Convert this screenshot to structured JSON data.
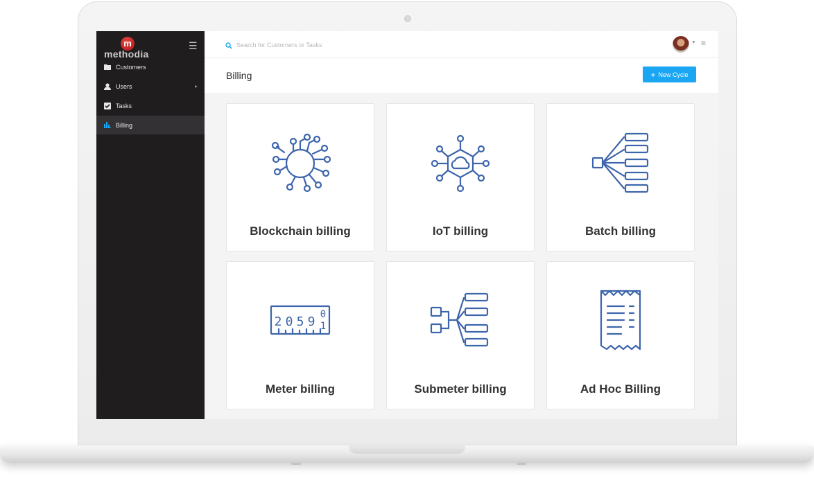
{
  "brand": {
    "logo_letter": "m",
    "logo_text": "methodia"
  },
  "sidebar": {
    "items": [
      {
        "label": "Customers",
        "icon": "folder-icon",
        "active": false
      },
      {
        "label": "Users",
        "icon": "user-icon",
        "active": false,
        "has_submenu": true
      },
      {
        "label": "Tasks",
        "icon": "checkbox-icon",
        "active": false
      },
      {
        "label": "Billing",
        "icon": "bar-chart-icon",
        "active": true
      }
    ]
  },
  "topbar": {
    "search_placeholder": "Search for Customers or Tasks"
  },
  "page": {
    "title": "Billing",
    "new_button_label": "New Cycle"
  },
  "cards": [
    {
      "label": "Blockchain billing",
      "icon": "blockchain-chip-icon"
    },
    {
      "label": "IoT billing",
      "icon": "iot-cloud-network-icon"
    },
    {
      "label": "Batch billing",
      "icon": "batch-tree-icon"
    },
    {
      "label": "Meter billing",
      "icon": "meter-counter-icon"
    },
    {
      "label": "Submeter billing",
      "icon": "submeter-tree-icon"
    },
    {
      "label": "Ad Hoc Billing",
      "icon": "receipt-icon"
    }
  ],
  "meter_display": {
    "digits": [
      "2",
      "0",
      "5",
      "9"
    ],
    "rolling_top": "0",
    "rolling_bottom": "1"
  },
  "colors": {
    "accent": "#1aa6f3",
    "icon_stroke": "#3d65ab",
    "sidebar_bg": "#1f1d1e",
    "sidebar_active": "#333133",
    "logo_red": "#c8201f"
  }
}
